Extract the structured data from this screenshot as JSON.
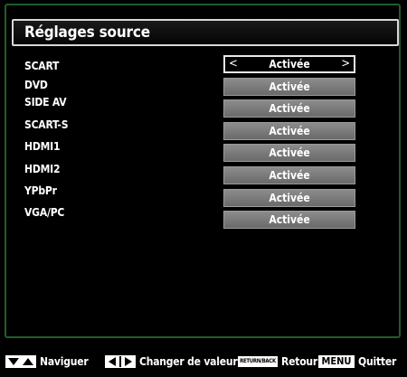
{
  "header": {
    "title": "Réglages source"
  },
  "sources": [
    {
      "label": "SCART",
      "value": "Activée",
      "selected": true
    },
    {
      "label": "DVD",
      "value": "Activée",
      "selected": false
    },
    {
      "label": "SIDE AV",
      "value": "Activée",
      "selected": false
    },
    {
      "label": "SCART-S",
      "value": "Activée",
      "selected": false
    },
    {
      "label": "HDMI1",
      "value": "Activée",
      "selected": false
    },
    {
      "label": "HDMI2",
      "value": "Activée",
      "selected": false
    },
    {
      "label": "YPbPr",
      "value": "Activée",
      "selected": false
    },
    {
      "label": "VGA/PC",
      "value": "Activée",
      "selected": false
    }
  ],
  "selector": {
    "left_arrow": "<",
    "right_arrow": ">"
  },
  "footer": {
    "navigate": "Naviguer",
    "change_value": "Changer de valeur",
    "back_key": "RETURN/BACK",
    "back": "Retour",
    "menu_key": "MENU",
    "quit": "Quitter"
  },
  "colors": {
    "frame_border": "#1f5e2a",
    "value_box": "#7a7a7a",
    "selected_border": "#e8e8e8"
  }
}
